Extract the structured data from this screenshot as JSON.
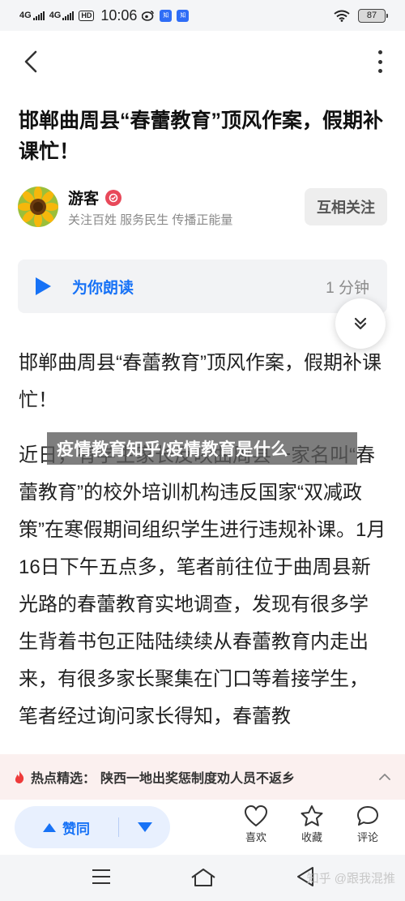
{
  "status_bar": {
    "signal_1": "4G",
    "signal_2": "4G",
    "hd": "HD",
    "time": "10:06",
    "battery": "87"
  },
  "article": {
    "title": "邯郸曲周县“春蕾教育”顶风作案，假期补课忙！",
    "author": {
      "name": "游客",
      "bio": "关注百姓 服务民生 传播正能量",
      "follow_label": "互相关注"
    },
    "read_aloud": {
      "label": "为你朗读",
      "duration": "1 分钟"
    },
    "paragraphs": [
      "邯郸曲周县“春蕾教育”顶风作案，假期补课忙！",
      "近日，有学生家长反映曲周县一家名叫“春蕾教育”的校外培训机构违反国家“双减政策”在寒假期间组织学生进行违规补课。1月16日下午五点多，笔者前往位于曲周县新光路的春蕾教育实地调查，发现有很多学生背着书包正陆陆续续从春蕾教育内走出来，有很多家长聚集在门口等着接学生，笔者经过询问家长得知，春蕾教"
    ],
    "overlay_banner": "疫情教育知乎/疫情教育是什么"
  },
  "hot_bar": {
    "label": "热点精选：",
    "text": "陕西一地出奖惩制度劝人员不返乡"
  },
  "action_bar": {
    "upvote_label": "赞同",
    "like_label": "喜欢",
    "collect_label": "收藏",
    "comment_label": "评论"
  },
  "watermark": "知乎 @跟我混推",
  "colors": {
    "accent": "#1772f6",
    "verify": "#e8495a",
    "hot_bg": "#fbf0ef"
  }
}
